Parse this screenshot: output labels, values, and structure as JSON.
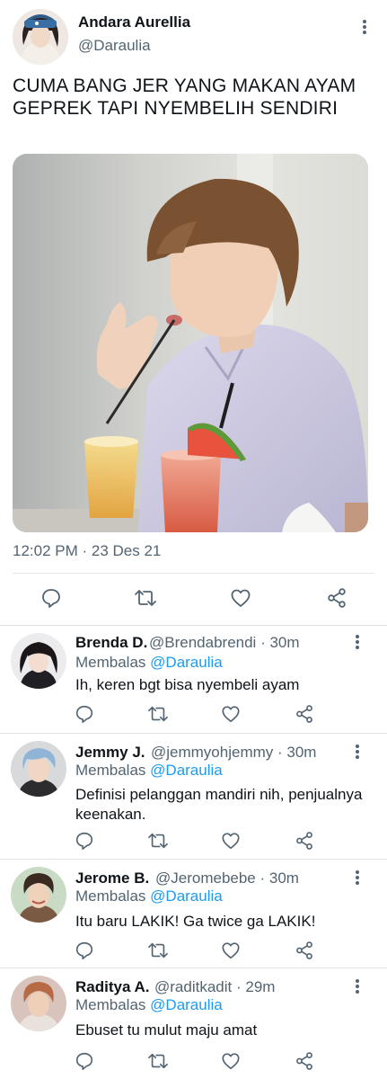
{
  "main_tweet": {
    "author_name": "Andara Aurellia",
    "author_handle": "@Daraulia",
    "text": "CUMA BANG JER YANG MAKAN AYAM GEPREK TAPI NYEMBELIH SENDIRI",
    "timestamp": "12:02 PM · 23 Des 21",
    "media_description": "photo"
  },
  "replies": [
    {
      "name": "Brenda D.",
      "handle": "@Brendabrendi",
      "time": "· 30m",
      "replying_label": "Membalas",
      "replying_to": "@Daraulia",
      "text": "Ih,  keren bgt bisa nyembeli ayam"
    },
    {
      "name": "Jemmy J.",
      "handle": "@jemmyohjemmy",
      "time": "· 30m",
      "replying_label": "Membalas",
      "replying_to": "@Daraulia",
      "text": "Definisi pelanggan mandiri nih, penjualnya keenakan."
    },
    {
      "name": "Jerome B.",
      "handle": "@Jeromebebe",
      "time": "· 30m",
      "replying_label": "Membalas",
      "replying_to": "@Daraulia",
      "text": "Itu baru LAKIK!  Ga twice ga LAKIK!"
    },
    {
      "name": "Raditya A.",
      "handle": "@raditkadit",
      "time": "· 29m",
      "replying_label": "Membalas",
      "replying_to": "@Daraulia",
      "text": "Ebuset tu mulut maju amat"
    }
  ],
  "icons": [
    "reply-icon",
    "retweet-icon",
    "like-icon",
    "share-icon",
    "more-icon"
  ],
  "colors": {
    "text": "#0f1419",
    "secondary": "#536471",
    "mention": "#1d9bf0",
    "divider": "#e6e9ec"
  }
}
